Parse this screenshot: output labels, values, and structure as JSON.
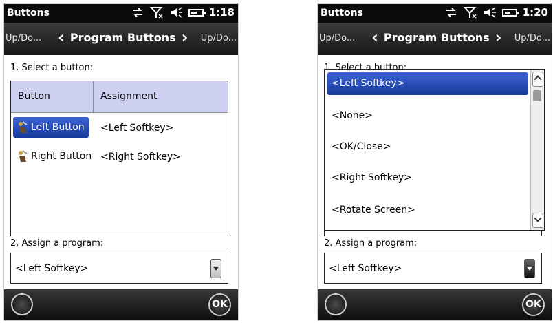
{
  "screen1": {
    "status": {
      "title": "Buttons",
      "time": "1:18"
    },
    "nav": {
      "prev": "Up/Do...",
      "title": "Program Buttons",
      "next": "Up/Do..."
    },
    "step1_label": "1. Select a button:",
    "table": {
      "headers": [
        "Button",
        "Assignment"
      ],
      "rows": [
        {
          "button": "Left Button",
          "assignment": "<Left Softkey>",
          "selected": true
        },
        {
          "button": "Right Button",
          "assignment": "<Right Softkey>",
          "selected": false
        }
      ]
    },
    "step2_label": "2. Assign a program:",
    "combo_value": "<Left Softkey>",
    "ok_label": "OK"
  },
  "screen2": {
    "status": {
      "title": "Buttons",
      "time": "1:20"
    },
    "nav": {
      "prev": "Up/Do...",
      "title": "Program Buttons",
      "next": "Up/Do..."
    },
    "step1_label": "1. Select a button:",
    "dropdown_options": [
      "<Left Softkey>",
      "<None>",
      "<OK/Close>",
      "<Right Softkey>",
      "<Rotate Screen>"
    ],
    "dropdown_selected_index": 0,
    "step2_label": "2. Assign a program:",
    "combo_value": "<Left Softkey>",
    "ok_label": "OK"
  },
  "colors": {
    "selection": "#2a4fc4",
    "header_bg": "#cdd0f1",
    "bar_dark": "#0b0b0b"
  },
  "icons": [
    "sync-icon",
    "signal-off-icon",
    "speaker-icon",
    "battery-icon",
    "button-hand-icon",
    "windows-start-icon"
  ]
}
